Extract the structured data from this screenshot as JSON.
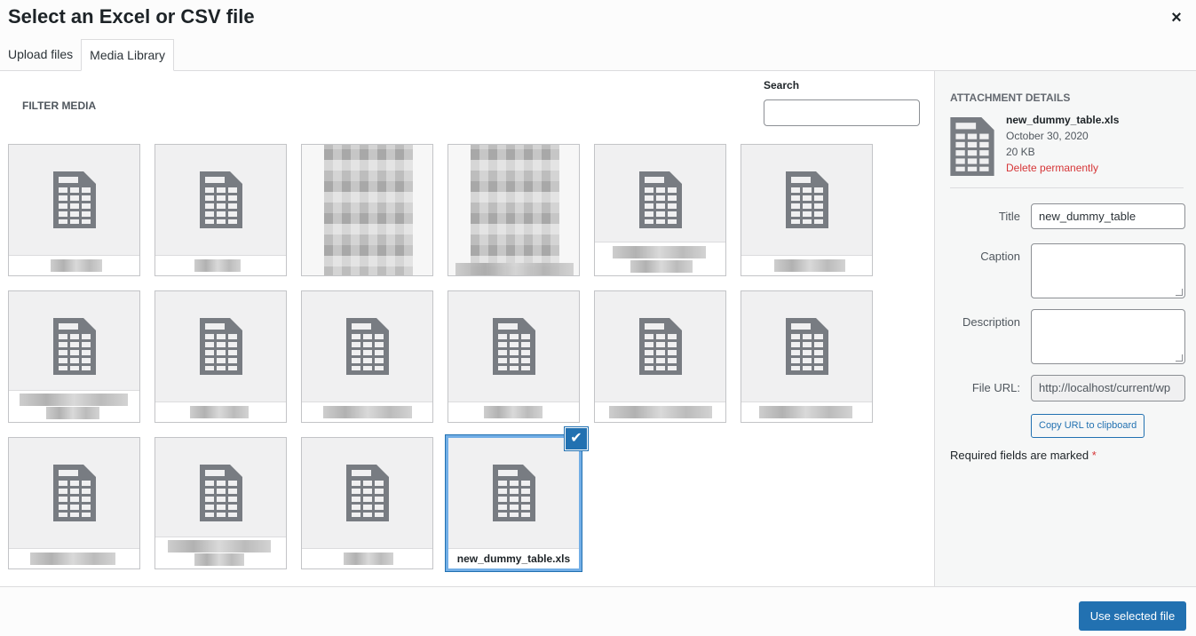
{
  "modal": {
    "title": "Select an Excel or CSV file",
    "close_icon": "×"
  },
  "tabs": [
    {
      "label": "Upload files"
    },
    {
      "label": "Media Library"
    }
  ],
  "toolbar": {
    "filter_label": "FILTER MEDIA",
    "search_label": "Search",
    "search_value": ""
  },
  "selected_file": {
    "filename": "new_dummy_table.xls",
    "check_icon": "✔"
  },
  "attachment": {
    "heading": "ATTACHMENT DETAILS",
    "filename": "new_dummy_table.xls",
    "date": "October 30, 2020",
    "size": "20 KB",
    "delete_label": "Delete permanently",
    "fields": {
      "title_label": "Title",
      "title_value": "new_dummy_table",
      "caption_label": "Caption",
      "caption_value": "",
      "description_label": "Description",
      "description_value": "",
      "url_label": "File URL:",
      "url_value": "http://localhost/current/wp"
    },
    "copy_label": "Copy URL to clipboard",
    "required_text": "Required fields are marked",
    "required_star": "*"
  },
  "footer": {
    "primary_label": "Use selected file"
  },
  "colors": {
    "accent": "#2271b1",
    "danger": "#d63638",
    "icon_gray": "#787c82"
  },
  "icons": {
    "spreadsheet": "spreadsheet-document-icon",
    "close": "close-icon",
    "check": "checkmark-icon"
  }
}
